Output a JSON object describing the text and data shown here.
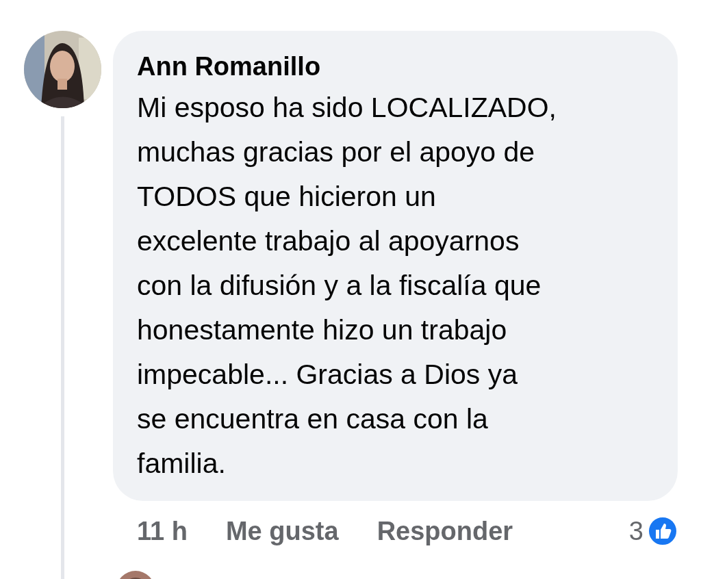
{
  "comment": {
    "author": "Ann Romanillo",
    "text": "Mi esposo ha sido LOCALIZADO,\nmuchas gracias por el apoyo de\nTODOS que hicieron un\nexcelente trabajo al apoyarnos\ncon la difusión y a la fiscalía que\nhonestamente hizo un trabajo\nimpecable... Gracias a Dios ya\nse encuentra en casa con la\nfamilia.",
    "time": "11 h",
    "actions": [
      "Me gusta",
      "Responder"
    ],
    "reaction_count": "3"
  }
}
